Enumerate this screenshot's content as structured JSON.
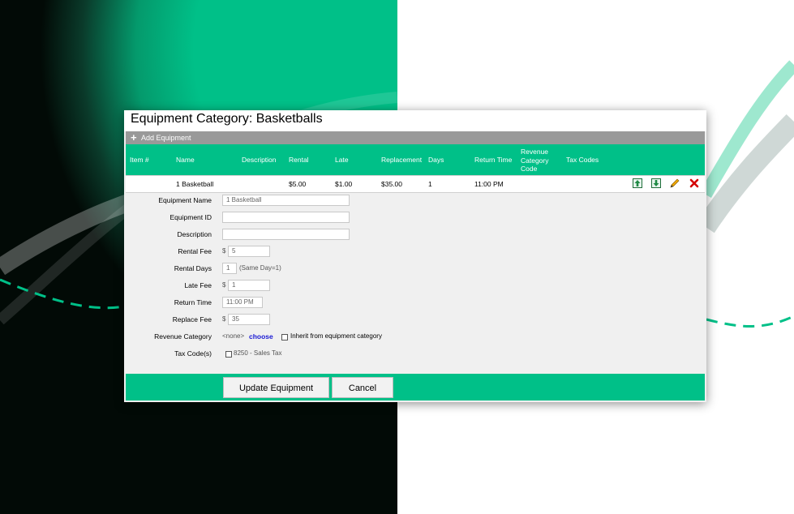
{
  "title": "Equipment Category: Basketballs",
  "add_label": "Add Equipment",
  "headers": {
    "item": "Item #",
    "name": "Name",
    "description": "Description",
    "rental": "Rental",
    "late": "Late",
    "replacement": "Replacement",
    "days": "Days",
    "return_time": "Return Time",
    "revenue_l1": "Revenue",
    "revenue_l2": "Category",
    "revenue_l3": "Code",
    "tax_codes": "Tax Codes"
  },
  "row": {
    "item": "",
    "name": "1 Basketball",
    "description": "",
    "rental": "$5.00",
    "late": "$1.00",
    "replacement": "$35.00",
    "days": "1",
    "return_time": "11:00 PM",
    "revenue": "",
    "tax_codes": ""
  },
  "row_actions": [
    "move-up-icon",
    "move-down-icon",
    "edit-pencil-icon",
    "delete-x-icon"
  ],
  "form": {
    "equipment_name_label": "Equipment Name",
    "equipment_name_value": "1 Basketball",
    "equipment_id_label": "Equipment ID",
    "equipment_id_value": "",
    "description_label": "Description",
    "description_value": "",
    "rental_fee_label": "Rental Fee",
    "rental_fee_value": "5",
    "rental_days_label": "Rental Days",
    "rental_days_value": "1",
    "rental_days_note": "(Same Day=1)",
    "late_fee_label": "Late Fee",
    "late_fee_value": "1",
    "return_time_label": "Return Time",
    "return_time_value": "11:00 PM",
    "replace_fee_label": "Replace Fee",
    "replace_fee_value": "35",
    "currency": "$",
    "revenue_category_label": "Revenue Category",
    "revenue_category_value": "<none>",
    "choose_link": "choose",
    "inherit_label": "Inherit from equipment category",
    "inherit_checked": false,
    "tax_codes_label": "Tax Code(s)",
    "tax_code_option": "8250 - Sales Tax",
    "tax_code_checked": false
  },
  "buttons": {
    "update": "Update Equipment",
    "cancel": "Cancel"
  },
  "colors": {
    "accent": "#00c088",
    "link": "#1a1ad4",
    "delete": "#d40000",
    "edit": "#f0a800"
  }
}
